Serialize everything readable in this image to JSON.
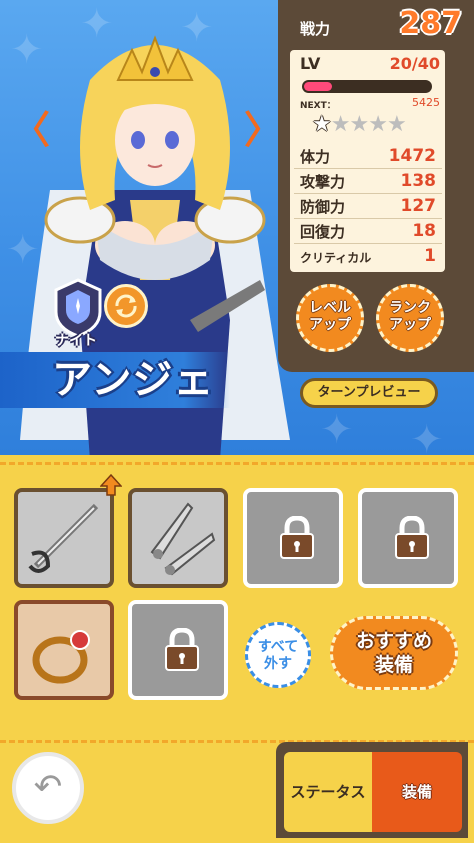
{
  "header": {
    "power_label": "戦力",
    "power_value": "287"
  },
  "stats": {
    "lv_label": "LV",
    "lv_value": "20/40",
    "exp_progress": 0.22,
    "next_label": "NEXT：",
    "next_value": "5425",
    "stars_filled": 1,
    "stars_total": 5,
    "rows": [
      {
        "name": "体力",
        "value": "1472"
      },
      {
        "name": "攻撃力",
        "value": "138"
      },
      {
        "name": "防御力",
        "value": "127"
      },
      {
        "name": "回復力",
        "value": "18"
      },
      {
        "name": "クリティカル",
        "value": "1"
      }
    ]
  },
  "actions": {
    "level_up_line1": "レベル",
    "level_up_line2": "アップ",
    "rank_up_line1": "ランク",
    "rank_up_line2": "アップ",
    "turn_preview": "ターンプレビュー"
  },
  "character": {
    "class_label": "ナイト",
    "name": "アンジェ"
  },
  "equipment": {
    "clear_line1": "すべて",
    "clear_line2": "外す",
    "recommend_line1": "おすすめ",
    "recommend_line2": "装備"
  },
  "tabs": {
    "status": "ステータス",
    "equip": "装備"
  },
  "colors": {
    "accent_orange": "#f28a1f",
    "panel_brown": "#5c4a38",
    "stat_value_red": "#e04a2a",
    "bg_blue": "#3a8ee6",
    "bottom_yellow": "#f6d24a"
  }
}
